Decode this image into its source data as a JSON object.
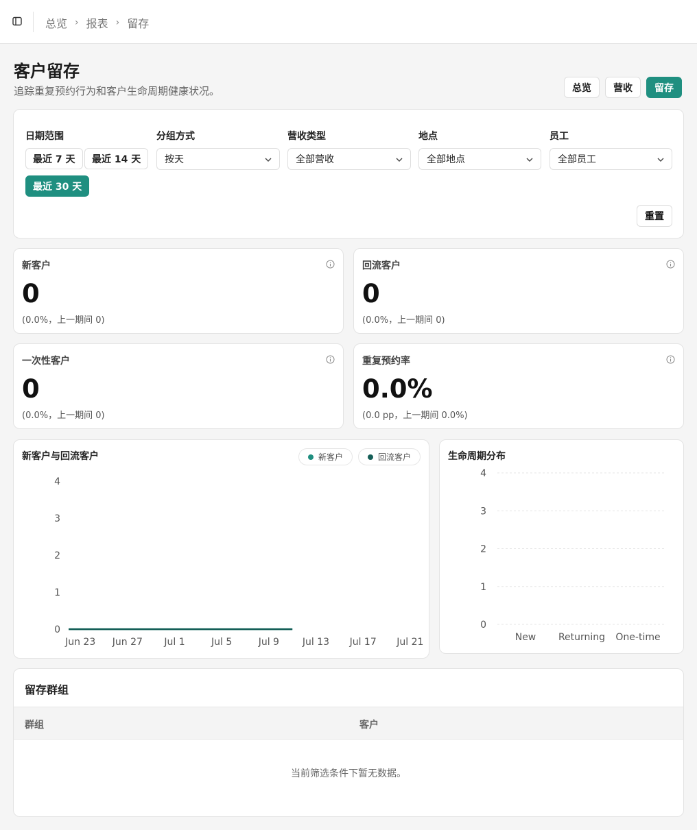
{
  "breadcrumb": [
    "总览",
    "报表",
    "留存"
  ],
  "page": {
    "title": "客户留存",
    "subtitle": "追踪重复预约行为和客户生命周期健康状况。"
  },
  "tabs": [
    {
      "label": "总览",
      "active": false
    },
    {
      "label": "营收",
      "active": false
    },
    {
      "label": "留存",
      "active": true
    }
  ],
  "filters": {
    "date_range": {
      "label": "日期范围",
      "options": [
        {
          "label": "最近 7 天",
          "active": false
        },
        {
          "label": "最近 14 天",
          "active": false
        },
        {
          "label": "最近 30 天",
          "active": true
        }
      ]
    },
    "group_by": {
      "label": "分组方式",
      "value": "按天"
    },
    "revenue_type": {
      "label": "营收类型",
      "value": "全部营收"
    },
    "location": {
      "label": "地点",
      "value": "全部地点"
    },
    "staff": {
      "label": "员工",
      "value": "全部员工"
    },
    "reset_label": "重置"
  },
  "metrics": [
    {
      "label": "新客户",
      "value": "0",
      "sub": "(0.0%，上一期间 0)"
    },
    {
      "label": "回流客户",
      "value": "0",
      "sub": "(0.0%，上一期间 0)"
    },
    {
      "label": "一次性客户",
      "value": "0",
      "sub": "(0.0%，上一期间 0)"
    },
    {
      "label": "重复预约率",
      "value": "0.0%",
      "sub": "(0.0 pp，上一期间 0.0%)"
    }
  ],
  "colors": {
    "accent": "#1f8f80",
    "series_new": "#1f8f80",
    "series_returning": "#155e57"
  },
  "chart_data": [
    {
      "type": "line",
      "title": "新客户与回流客户",
      "x_ticks": [
        "Jun 23",
        "Jun 27",
        "Jul 1",
        "Jul 5",
        "Jul 9",
        "Jul 13",
        "Jul 17",
        "Jul 21"
      ],
      "x_range": [
        "Jun 22",
        "Jul 22"
      ],
      "x_data_end": "Jul 11",
      "y_ticks": [
        0,
        1,
        2,
        3,
        4
      ],
      "ylim": [
        0,
        4
      ],
      "grid": false,
      "legend": "top-right",
      "series": [
        {
          "name": "新客户",
          "values": [
            0,
            0
          ]
        },
        {
          "name": "回流客户",
          "values": [
            0,
            0
          ]
        }
      ]
    },
    {
      "type": "bar",
      "title": "生命周期分布",
      "categories": [
        "New",
        "Returning",
        "One-time"
      ],
      "values": [
        0,
        0,
        0
      ],
      "y_ticks": [
        0,
        1,
        2,
        3,
        4
      ],
      "ylim": [
        0,
        4
      ],
      "grid": true
    }
  ],
  "cohorts": {
    "title": "留存群组",
    "columns": [
      "群组",
      "客户"
    ],
    "empty_message": "当前筛选条件下暂无数据。"
  }
}
